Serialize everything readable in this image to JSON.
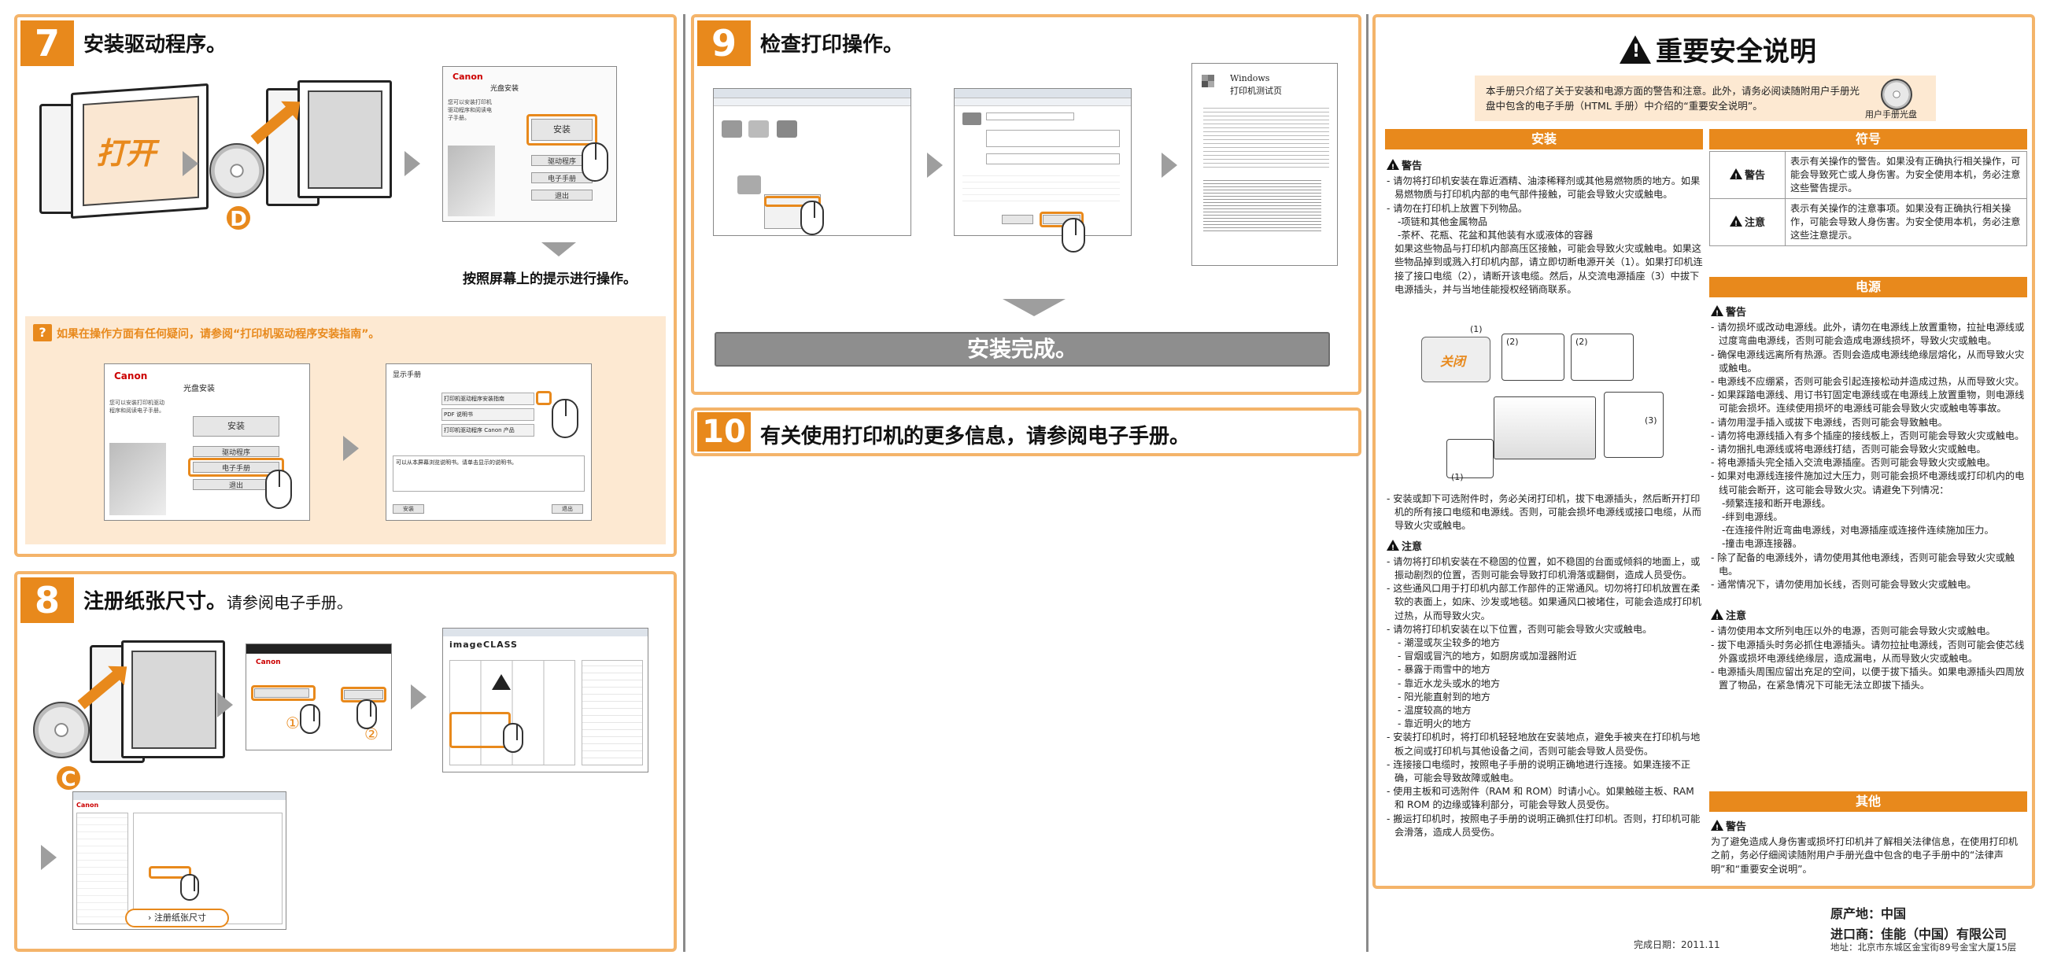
{
  "step7": {
    "num": "7",
    "title": "安装驱动程序。",
    "open_label": "打开",
    "disc_letter": "D",
    "installer_brand": "Canon",
    "installer_window": "光盘安装",
    "installer_side_text": "您可以安装打印机驱动程序和阅读电子手册。",
    "installer_buttons": [
      "安装",
      "驱动程序",
      "电子手册",
      "退出"
    ],
    "instruction": "按照屏幕上的提示进行操作。",
    "hint": "如果在操作方面有任何疑问，请参阅“打印机驱动程序安装指南”。",
    "manual_window": "显示手册",
    "manual_rows": [
      "打印机驱动程序安装指南",
      "PDF 说明书",
      "打印机驱动程序 Canon 产品"
    ],
    "manual_note": "可以从本屏幕浏览说明书。请单击显示的说明书。",
    "manual_buttons": [
      "安装",
      "退出"
    ]
  },
  "step8": {
    "num": "8",
    "title": "注册纸张尺寸。",
    "subtitle": "请参阅电子手册。",
    "disc_letter": "C",
    "callouts": [
      "①",
      "②"
    ],
    "manual_brand": "imageCLASS",
    "link_label": "注册纸张尺寸"
  },
  "step9": {
    "num": "9",
    "title": "检查打印操作。",
    "test_page_title_1": "Windows",
    "test_page_title_2": "打印机测试页",
    "done": "安装完成。"
  },
  "step10": {
    "num": "10",
    "title": "有关使用打印机的更多信息，请参阅电子手册。"
  },
  "safety": {
    "title": "重要安全说明",
    "intro": "本手册只介绍了关于安装和电源方面的警告和注意。此外，请务必阅读随附用户手册光盘中包含的电子手册（HTML 手册）中介绍的“重要安全说明”。",
    "cd_label": "用户手册光盘",
    "install": {
      "header": "安装",
      "warning_label": "警告",
      "warning_items": [
        "请勿将打印机安装在靠近酒精、油漆稀释剂或其他易燃物质的地方。如果易燃物质与打印机内部的电气部件接触，可能会导致火灾或触电。",
        "请勿在打印机上放置下列物品。"
      ],
      "warning_subitems": [
        "项链和其他金属物品",
        "茶杯、花瓶、花盆和其他装有水或液体的容器"
      ],
      "warning_cont": "如果这些物品与打印机内部高压区接触，可能会导致火灾或触电。如果这些物品掉到或溅入打印机内部，请立即切断电源开关（1）。如果打印机连接了接口电缆（2），请断开该电缆。然后，从交流电源插座（3）中拔下电源插头，并与当地佳能授权经销商联系。",
      "diagram_labels": [
        "(1)",
        "(2)",
        "(2)",
        "(3)",
        "(1)"
      ],
      "diagram_off": "关闭",
      "warning_item2": "安装或卸下可选附件时，务必关闭打印机，拔下电源插头，然后断开打印机的所有接口电缆和电源线。否则，可能会损坏电源线或接口电缆，从而导致火灾或触电。",
      "caution_label": "注意",
      "caution_items": [
        "请勿将打印机安装在不稳固的位置，如不稳固的台面或倾斜的地面上，或振动剧烈的位置，否则可能会导致打印机滑落或翻倒，造成人员受伤。",
        "这些通风口用于打印机内部工作部件的正常通风。切勿将打印机放置在柔软的表面上，如床、沙发或地毯。如果通风口被堵住，可能会造成打印机过热，从而导致火灾。",
        "请勿将打印机安装在以下位置，否则可能会导致火灾或触电。"
      ],
      "caution_subitems": [
        "潮湿或灰尘较多的地方",
        "冒烟或冒汽的地方，如厨房或加湿器附近",
        "暴露于雨雪中的地方",
        "靠近水龙头或水的地方",
        "阳光能直射到的地方",
        "温度较高的地方",
        "靠近明火的地方"
      ],
      "caution_items2": [
        "安装打印机时，将打印机轻轻地放在安装地点，避免手被夹在打印机与地板之间或打印机与其他设备之间，否则可能会导致人员受伤。",
        "连接接口电缆时，按照电子手册的说明正确地进行连接。如果连接不正确，可能会导致故障或触电。",
        "使用主板和可选附件（RAM 和 ROM）时请小心。如果触碰主板、RAM 和 ROM 的边缘或锋利部分，可能会导致人员受伤。",
        "搬运打印机时，按照电子手册的说明正确抓住打印机。否则，打印机可能会滑落，造成人员受伤。"
      ]
    },
    "symbols": {
      "header": "符号",
      "rows": [
        {
          "key": "警告",
          "text": "表示有关操作的警告。如果没有正确执行相关操作，可能会导致死亡或人身伤害。为安全使用本机，务必注意这些警告提示。"
        },
        {
          "key": "注意",
          "text": "表示有关操作的注意事项。如果没有正确执行相关操作，可能会导致人身伤害。为安全使用本机，务必注意这些注意提示。"
        }
      ]
    },
    "power": {
      "header": "电源",
      "warning_label": "警告",
      "warning_items": [
        "请勿损坏或改动电源线。此外，请勿在电源线上放置重物，拉扯电源线或过度弯曲电源线，否则可能会造成电源线损坏，导致火灾或触电。",
        "确保电源线远离所有热源。否则会造成电源线绝缘层熔化，从而导致火灾或触电。",
        "电源线不应绷紧，否则可能会引起连接松动并造成过热，从而导致火灾。",
        "如果踩踏电源线、用订书钉固定电源线或在电源线上放置重物，则电源线可能会损坏。连续使用损坏的电源线可能会导致火灾或触电等事故。",
        "请勿用湿手插入或拔下电源线，否则可能会导致触电。",
        "请勿将电源线插入有多个插座的接线板上，否则可能会导致火灾或触电。",
        "请勿捆扎电源线或将电源线打结，否则可能会导致火灾或触电。",
        "将电源插头完全插入交流电源插座。否则可能会导致火灾或触电。",
        "如果对电源线连接件施加过大压力，则可能会损坏电源线或打印机内的电线可能会断开，这可能会导致火灾。请避免下列情况："
      ],
      "warning_subitems": [
        "频繁连接和断开电源线。",
        "绊到电源线。",
        "在连接件附近弯曲电源线，对电源插座或连接件连续施加压力。",
        "撞击电源连接器。"
      ],
      "warning_items2": [
        "除了配备的电源线外，请勿使用其他电源线，否则可能会导致火灾或触电。",
        "通常情况下，请勿使用加长线，否则可能会导致火灾或触电。"
      ],
      "caution_label": "注意",
      "caution_items": [
        "请勿使用本文所列电压以外的电源，否则可能会导致火灾或触电。",
        "拔下电源插头时务必抓住电源插头。请勿拉扯电源线，否则可能会使芯线外露或损坏电源线绝缘层，造成漏电，从而导致火灾或触电。",
        "电源插头周围应留出充足的空间，以便于拔下插头。如果电源插头四周放置了物品，在紧急情况下可能无法立即拔下插头。"
      ]
    },
    "other": {
      "header": "其他",
      "warning_label": "警告",
      "text": "为了避免造成人身伤害或损坏打印机并了解相关法律信息，在使用打印机之前，务必仔细阅读随附用户手册光盘中包含的电子手册中的“法律声明”和“重要安全说明”。"
    }
  },
  "footer": {
    "origin": "原产地：中国",
    "importer": "进口商：佳能（中国）有限公司",
    "address": "地址：北京市东城区金宝街89号金宝大厦15层",
    "date": "完成日期：2011.11"
  }
}
